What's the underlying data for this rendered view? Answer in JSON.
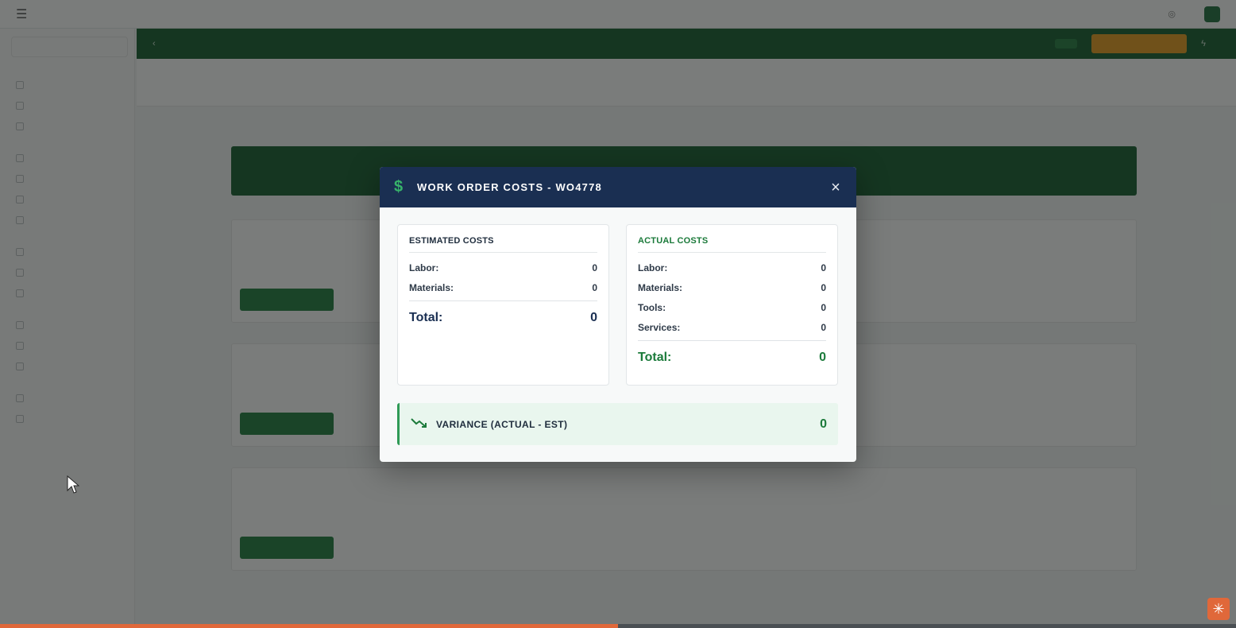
{
  "modal": {
    "title": "WORK ORDER COSTS - WO4778",
    "close_label": "×",
    "estimated": {
      "title": "ESTIMATED COSTS",
      "rows": [
        {
          "label": "Labor:",
          "value": "0"
        },
        {
          "label": "Materials:",
          "value": "0"
        }
      ],
      "total_label": "Total:",
      "total_value": "0"
    },
    "actual": {
      "title": "ACTUAL COSTS",
      "rows": [
        {
          "label": "Labor:",
          "value": "0"
        },
        {
          "label": "Materials:",
          "value": "0"
        },
        {
          "label": "Tools:",
          "value": "0"
        },
        {
          "label": "Services:",
          "value": "0"
        }
      ],
      "total_label": "Total:",
      "total_value": "0"
    },
    "variance": {
      "label": "VARIANCE (ACTUAL - EST)",
      "value": "0"
    }
  },
  "icons": {
    "modal_header": "dollar-icon",
    "close": "close-icon",
    "variance": "trending-down-icon",
    "assistant": "sparkle-icon"
  },
  "colors": {
    "modal_header_bg": "#1a2f52",
    "accent_green": "#1b7a3a",
    "toolbar_green": "#0f5a2a",
    "orange": "#e89a1a",
    "variance_bg": "#e9f6ee"
  },
  "page_progress": 0.5
}
